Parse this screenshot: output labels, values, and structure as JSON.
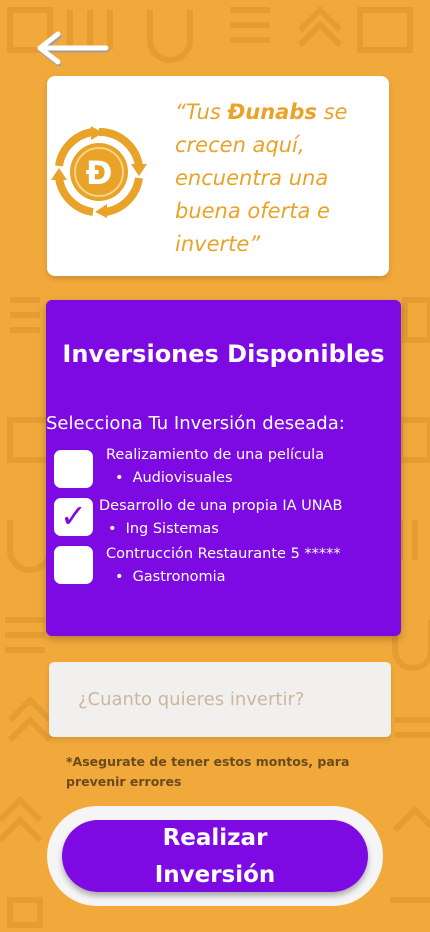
{
  "header": {
    "back_icon": "arrow-left-icon"
  },
  "quote_card": {
    "coin_icon": "dunab-coin-icon",
    "quote_prefix": "“Tus ",
    "quote_brand": "Đunabs",
    "quote_suffix": " se crecen aquí, encuentra una buena oferta e inverte”"
  },
  "investments": {
    "title": "Inversiones Disponibles",
    "subtitle": "Selecciona Tu Inversión deseada:",
    "options": [
      {
        "name": "Realizamiento de una película",
        "category": "Audiovisuales",
        "checked": false
      },
      {
        "name": "Desarrollo de una propia IA UNAB",
        "category": "Ing Sistemas",
        "checked": true
      },
      {
        "name": "Contrucción Restaurante 5 *****",
        "category": "Gastronomia",
        "checked": false
      }
    ],
    "check_glyph": "✓"
  },
  "amount": {
    "placeholder": "¿Cuanto quieres invertir?",
    "value": ""
  },
  "warning": "*Asegurate de tener estos montos, para prevenir errores",
  "submit": {
    "label": "Realizar Inversión"
  },
  "colors": {
    "background": "#F2A93B",
    "accent": "#7D0AE2",
    "gold": "#E9A328"
  }
}
